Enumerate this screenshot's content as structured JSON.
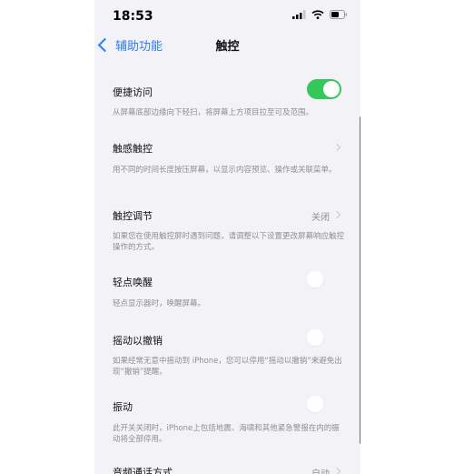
{
  "status": {
    "time": "18:53"
  },
  "nav": {
    "back_label": "辅助功能",
    "title": "触控"
  },
  "rows": [
    {
      "title": "便捷访问",
      "desc": "从屏幕底部边缘向下轻扫，将屏幕上方项目拉至可及范围。",
      "toggle": true
    },
    {
      "title": "触感触控",
      "desc": "用不同的时间长度按压屏幕，以显示内容预览、操作或关联菜单。"
    },
    {
      "title": "触控调节",
      "value": "关闭",
      "desc": "如果您在使用触控屏时遇到问题，请调整以下设置更改屏幕响应触控操作的方式。"
    },
    {
      "title": "轻点唤醒",
      "desc": "轻点显示器时，唤醒屏幕。",
      "toggle": false
    },
    {
      "title": "摇动以撤销",
      "desc": "如果经常无意中摇动到 iPhone，您可以停用“摇动以撤销”来避免出现“撤销”提醒。",
      "toggle": false
    },
    {
      "title": "振动",
      "desc": "此开关关闭时，iPhone上包括地震、海啸和其他紧急警报在内的振动将全部停用。",
      "toggle": false
    },
    {
      "title": "音频通话方式",
      "value": "自动"
    }
  ],
  "colors": {
    "accent": "#2f7cf6",
    "toggle_on": "#34c759"
  }
}
